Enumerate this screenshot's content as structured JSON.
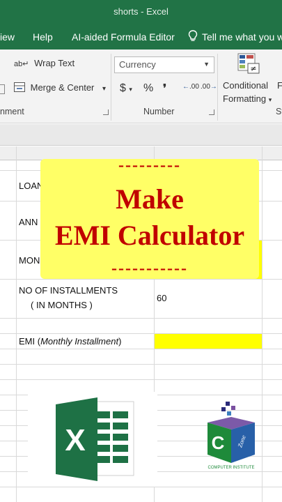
{
  "window": {
    "title": "shorts - Excel"
  },
  "tabs": {
    "view": "iew",
    "help": "Help",
    "ai": "AI-aided Formula Editor",
    "tell": "Tell me what you wa"
  },
  "ribbon": {
    "wrap_text": "Wrap Text",
    "merge_center": "Merge & Center",
    "merge_caret": "▾",
    "number_format": "Currency",
    "currency_symbol": "$",
    "percent_symbol": "%",
    "comma_symbol": "❜",
    "increase_decimal": ".00",
    "decrease_decimal": ".00",
    "conditional": "Conditional",
    "formatting": "Formatting",
    "alignment_group": "nment",
    "number_group": "Number",
    "styles_group_partial": "St",
    "format_partial": "F"
  },
  "sheet": {
    "rows": {
      "loan": "LOAN",
      "annual": "ANN",
      "monthly": "MON",
      "installments_line1": "NO OF INSTALLMENTS",
      "installments_line2": "( IN MONTHS  )",
      "installments_value": "60",
      "emi_prefix": "EMI (",
      "emi_italic": "Monthly Installment",
      "emi_suffix": ")"
    }
  },
  "overlay": {
    "dashes_top": "---------",
    "line1": "Make",
    "line2": "EMI Calculator",
    "dashes_bottom": "-----------"
  },
  "logos": {
    "excel_letter": "X",
    "cz_letter": "C",
    "cz_zone": "Zone",
    "cz_caption": "COMPUTER INSTITUTE"
  },
  "colors": {
    "excel_green": "#217346",
    "highlight_yellow": "#ffff00",
    "banner_yellow": "#ffff66",
    "headline_red": "#c00000"
  }
}
